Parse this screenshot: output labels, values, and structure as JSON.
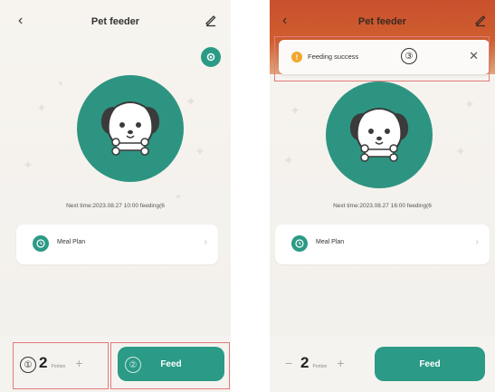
{
  "left_screen": {
    "header": {
      "title": "Pet feeder",
      "back_icon": "chevron-left-icon",
      "edit_icon": "edit-icon"
    },
    "next_time": "Next time:2023.08.27 10:00 feeding(6",
    "meal_plan": {
      "label": "Meal Plan",
      "icon": "clock-icon"
    },
    "stepper": {
      "count": "2",
      "unit": "Portion",
      "minus": "−",
      "plus": "+"
    },
    "feed_button": "Feed",
    "callouts": {
      "stepper": "①",
      "feed": "②"
    }
  },
  "right_screen": {
    "header": {
      "title": "Pet feeder"
    },
    "toast": {
      "text": "Feeding success",
      "icon": "info-icon"
    },
    "next_time": "Next time:2023.08.27 16:00 feeding(6",
    "meal_plan": {
      "label": "Meal Plan"
    },
    "stepper": {
      "count": "2",
      "unit": "Portion",
      "minus": "−",
      "plus": "+"
    },
    "feed_button": "Feed",
    "callouts": {
      "toast": "③"
    }
  },
  "colors": {
    "accent": "#2b9a86",
    "avatar_bg": "#2e9482",
    "highlight": "#e27b7b",
    "top_band": "#c9502c",
    "toast_icon": "#f2a72c"
  }
}
